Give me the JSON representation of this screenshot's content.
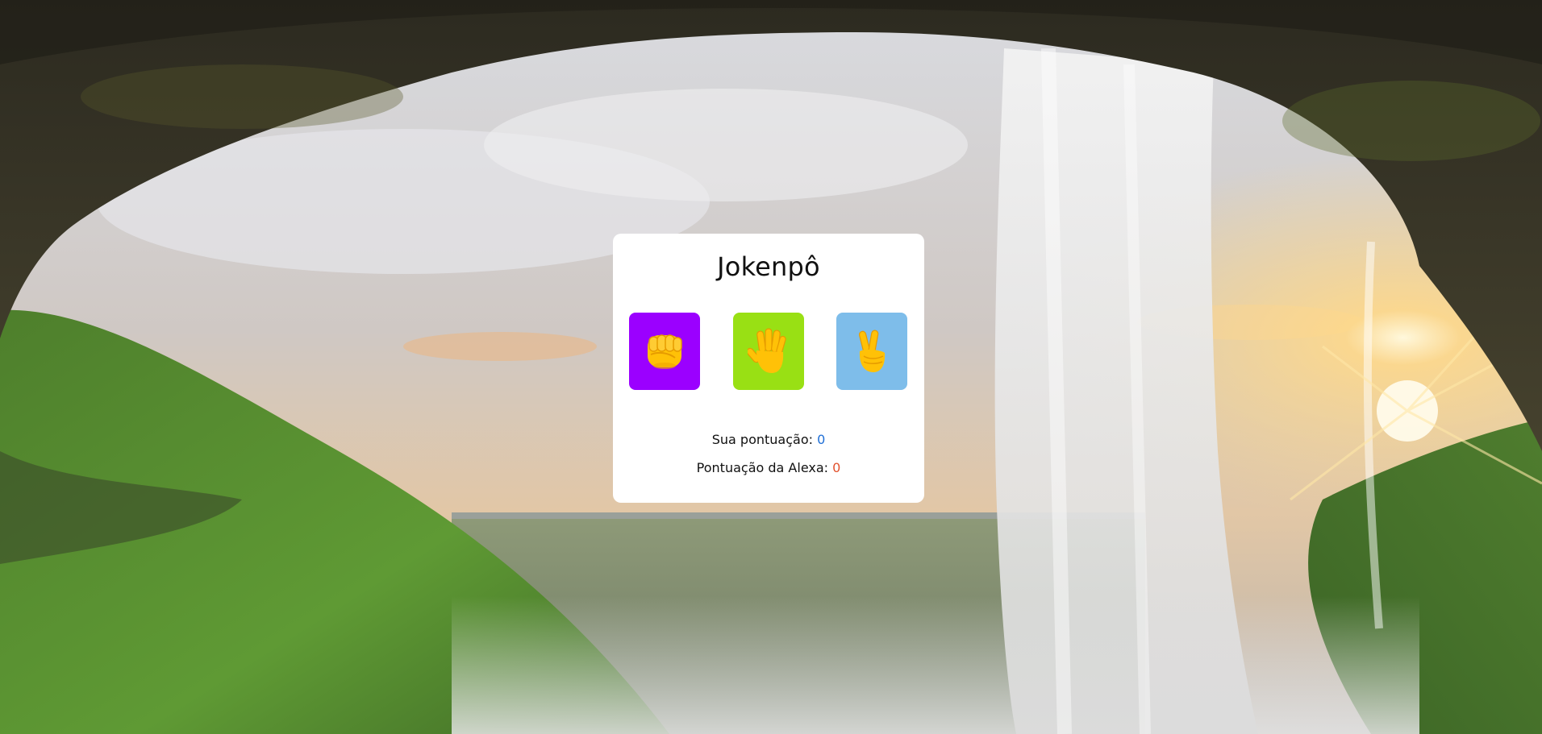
{
  "game": {
    "title": "Jokenpô",
    "choices": [
      {
        "name": "rock",
        "icon": "fist-icon",
        "color": "#9b00ff"
      },
      {
        "name": "paper",
        "icon": "open-hand-icon",
        "color": "#99e014"
      },
      {
        "name": "scissors",
        "icon": "victory-hand-icon",
        "color": "#7ebdea"
      }
    ],
    "player_score_label": "Sua pontuação:",
    "player_score": "0",
    "alexa_score_label": "Pontuação da Alexa:",
    "alexa_score": "0"
  },
  "colors": {
    "player_score": "#1f6fd6",
    "alexa_score": "#e2522e",
    "card": "#ffffff"
  }
}
